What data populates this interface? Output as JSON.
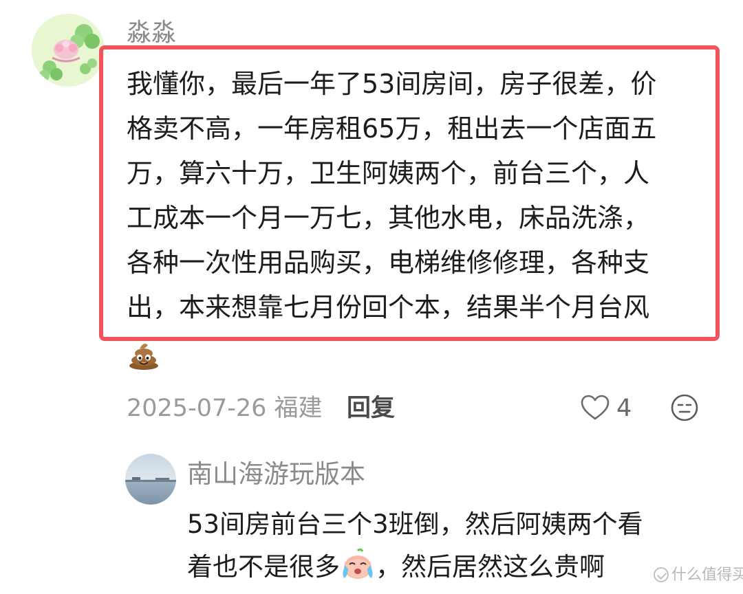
{
  "comment": {
    "username": "淼淼",
    "lines": [
      "我懂你，最后一年了53间房间，房子很差，价",
      "格卖不高，一年房租65万，租出去一个店面五",
      "万，算六十万，卫生阿姨两个，前台三个，人",
      "工成本一个月一万七，其他水电，床品洗涤，",
      "各种一次性用品购买，电梯维修修理，各种支",
      "出，本来想靠七月份回个本，结果半个月台风"
    ],
    "trailing_emoji": "poop-emoji",
    "date_location": "2025-07-26 福建",
    "reply_label": "回复",
    "like_count": "4",
    "highlight_color": "#f0555d"
  },
  "reply": {
    "username": "南山海游玩版本",
    "line1": "53间房前台三个3班倒，然后阿姨两个看",
    "line2_before": "着也不是很多",
    "line2_emoji": "crying-emoji",
    "line2_after": "，然后居然这么贵啊"
  },
  "watermark": {
    "text": "什么值得买"
  }
}
